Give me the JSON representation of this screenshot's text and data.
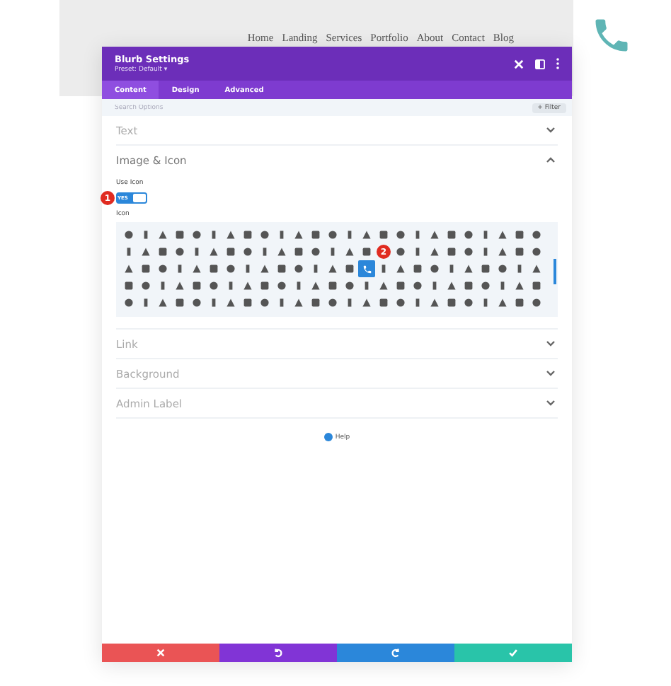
{
  "site_nav": [
    "Home",
    "Landing",
    "Services",
    "Portfolio",
    "About",
    "Contact",
    "Blog"
  ],
  "modal": {
    "title": "Blurb Settings",
    "preset": "Preset: Default ▾"
  },
  "tabs": [
    {
      "label": "Content",
      "selected": true
    },
    {
      "label": "Design",
      "selected": false
    },
    {
      "label": "Advanced",
      "selected": false
    }
  ],
  "search": {
    "placeholder": "Search Options"
  },
  "filter_button": "+ Filter",
  "sections_before": [
    {
      "title": "Text",
      "expanded": false
    },
    {
      "title": "Image & Icon",
      "expanded": true
    }
  ],
  "use_icon": {
    "label": "Use Icon",
    "toggle_text": "YES",
    "on": true,
    "marker": "1"
  },
  "icon_label": "Icon",
  "icon_marker": "2",
  "icon_rows": [
    [
      {
        "selected": false
      },
      {
        "selected": false
      },
      {
        "selected": false
      },
      {
        "selected": false
      },
      {
        "selected": false
      },
      {
        "selected": false
      },
      {
        "selected": false
      },
      {
        "selected": false
      },
      {
        "selected": false
      },
      {
        "selected": false
      },
      {
        "selected": false
      },
      {
        "selected": false
      },
      {
        "selected": false
      },
      {
        "selected": false
      },
      {
        "selected": false
      },
      {
        "selected": false
      },
      {
        "selected": false
      },
      {
        "selected": false
      },
      {
        "selected": false
      },
      {
        "selected": false
      },
      {
        "selected": false
      },
      {
        "selected": false
      },
      {
        "selected": false
      },
      {
        "selected": false
      },
      {
        "selected": false
      }
    ],
    [
      {
        "selected": false
      },
      {
        "selected": false
      },
      {
        "selected": false
      },
      {
        "selected": false
      },
      {
        "selected": false
      },
      {
        "selected": false
      },
      {
        "selected": false
      },
      {
        "selected": false
      },
      {
        "selected": false
      },
      {
        "selected": false
      },
      {
        "selected": false
      },
      {
        "selected": false
      },
      {
        "selected": false
      },
      {
        "selected": false
      },
      {
        "selected": false
      },
      {
        "selected": false
      },
      {
        "selected": false
      },
      {
        "selected": false
      },
      {
        "selected": false
      },
      {
        "selected": false
      },
      {
        "selected": false
      },
      {
        "selected": false
      },
      {
        "selected": false
      },
      {
        "selected": false
      }
    ],
    [
      {
        "selected": false
      },
      {
        "selected": false
      },
      {
        "selected": false
      },
      {
        "selected": false
      },
      {
        "selected": false
      },
      {
        "selected": false
      },
      {
        "selected": false
      },
      {
        "selected": false
      },
      {
        "selected": false
      },
      {
        "selected": false
      },
      {
        "selected": false
      },
      {
        "selected": false
      },
      {
        "selected": false
      },
      {
        "selected": false
      },
      {
        "selected": true
      },
      {
        "selected": false
      },
      {
        "selected": false
      },
      {
        "selected": false
      },
      {
        "selected": false
      },
      {
        "selected": false
      },
      {
        "selected": false
      },
      {
        "selected": false
      },
      {
        "selected": false
      },
      {
        "selected": false
      },
      {
        "selected": false
      }
    ],
    [
      {
        "selected": false
      },
      {
        "selected": false
      },
      {
        "selected": false
      },
      {
        "selected": false
      },
      {
        "selected": false
      },
      {
        "selected": false
      },
      {
        "selected": false
      },
      {
        "selected": false
      },
      {
        "selected": false
      },
      {
        "selected": false
      },
      {
        "selected": false
      },
      {
        "selected": false
      },
      {
        "selected": false
      },
      {
        "selected": false
      },
      {
        "selected": false
      },
      {
        "selected": false
      },
      {
        "selected": false
      },
      {
        "selected": false
      },
      {
        "selected": false
      },
      {
        "selected": false
      },
      {
        "selected": false
      },
      {
        "selected": false
      },
      {
        "selected": false
      },
      {
        "selected": false
      },
      {
        "selected": false
      }
    ],
    [
      {
        "selected": false
      },
      {
        "selected": false
      },
      {
        "selected": false
      },
      {
        "selected": false
      },
      {
        "selected": false
      },
      {
        "selected": false
      },
      {
        "selected": false
      },
      {
        "selected": false
      },
      {
        "selected": false
      },
      {
        "selected": false
      },
      {
        "selected": false
      },
      {
        "selected": false
      },
      {
        "selected": false
      },
      {
        "selected": false
      },
      {
        "selected": false
      },
      {
        "selected": false
      },
      {
        "selected": false
      },
      {
        "selected": false
      },
      {
        "selected": false
      },
      {
        "selected": false
      },
      {
        "selected": false
      },
      {
        "selected": false
      },
      {
        "selected": false
      },
      {
        "selected": false
      },
      {
        "selected": false
      }
    ]
  ],
  "sections_after": [
    {
      "title": "Link",
      "expanded": false
    },
    {
      "title": "Background",
      "expanded": false
    },
    {
      "title": "Admin Label",
      "expanded": false
    }
  ],
  "help": "Help",
  "footer_buttons": [
    {
      "kind": "discard",
      "color": "#ea5455"
    },
    {
      "kind": "undo",
      "color": "#8134d6"
    },
    {
      "kind": "redo",
      "color": "#2b87da"
    },
    {
      "kind": "save",
      "color": "#29c4a9"
    }
  ]
}
